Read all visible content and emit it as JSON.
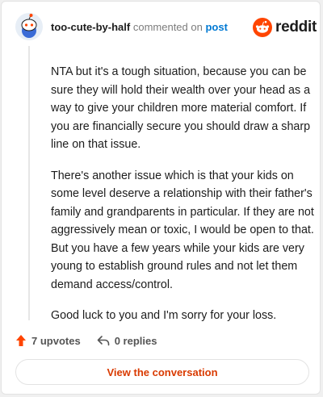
{
  "header": {
    "username": "too-cute-by-half",
    "action_text": "commented on",
    "post_link": "post",
    "brand": "reddit"
  },
  "comment": {
    "paragraphs": [
      "NTA but it's a tough situation, because you can be sure they will hold their wealth over your head as a way to give your children more material comfort. If you are financially secure you should draw a sharp line on that issue.",
      "There's another issue which is that your kids on some level deserve a relationship with their father's family and grandparents in particular. If they are not aggressively mean or toxic, I would be open to that. But you have a few years while your kids are very young to establish ground rules and not let them demand access/control.",
      "Good luck to you and I'm sorry for your loss."
    ]
  },
  "actions": {
    "upvotes": "7 upvotes",
    "replies": "0 replies"
  },
  "cta": {
    "label": "View the conversation"
  },
  "colors": {
    "brand": "#ff4500",
    "link": "#0079d3",
    "cta_text": "#d93a00",
    "upvote": "#ff4500"
  },
  "icons": {
    "avatar": "snoo-avatar-icon",
    "logo": "reddit-logo-icon",
    "upvote": "upvote-arrow-icon",
    "reply": "reply-arrow-icon"
  }
}
